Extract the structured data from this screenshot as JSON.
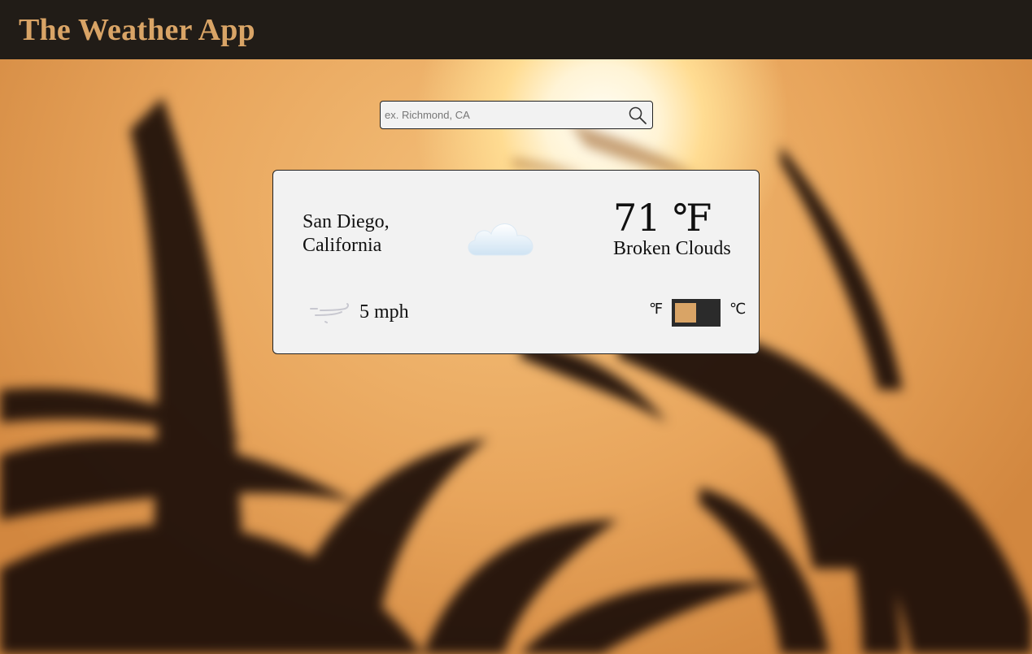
{
  "header": {
    "title": "The Weather App"
  },
  "search": {
    "placeholder": "ex. Richmond, CA",
    "value": "",
    "button_icon": "search-icon"
  },
  "weather": {
    "location": "San Diego, California",
    "condition_icon": "cloud-moon-icon",
    "temperature": "71 ℉",
    "description": "Broken Clouds",
    "wind_icon": "wind-icon",
    "wind_speed": "5 mph"
  },
  "units": {
    "fahrenheit_label": "℉",
    "celsius_label": "℃",
    "selected": "fahrenheit"
  },
  "colors": {
    "header_bg": "#211c17",
    "accent": "#d9a466",
    "card_bg": "#f2f2f2",
    "toggle_bg": "#2b2b2b"
  }
}
